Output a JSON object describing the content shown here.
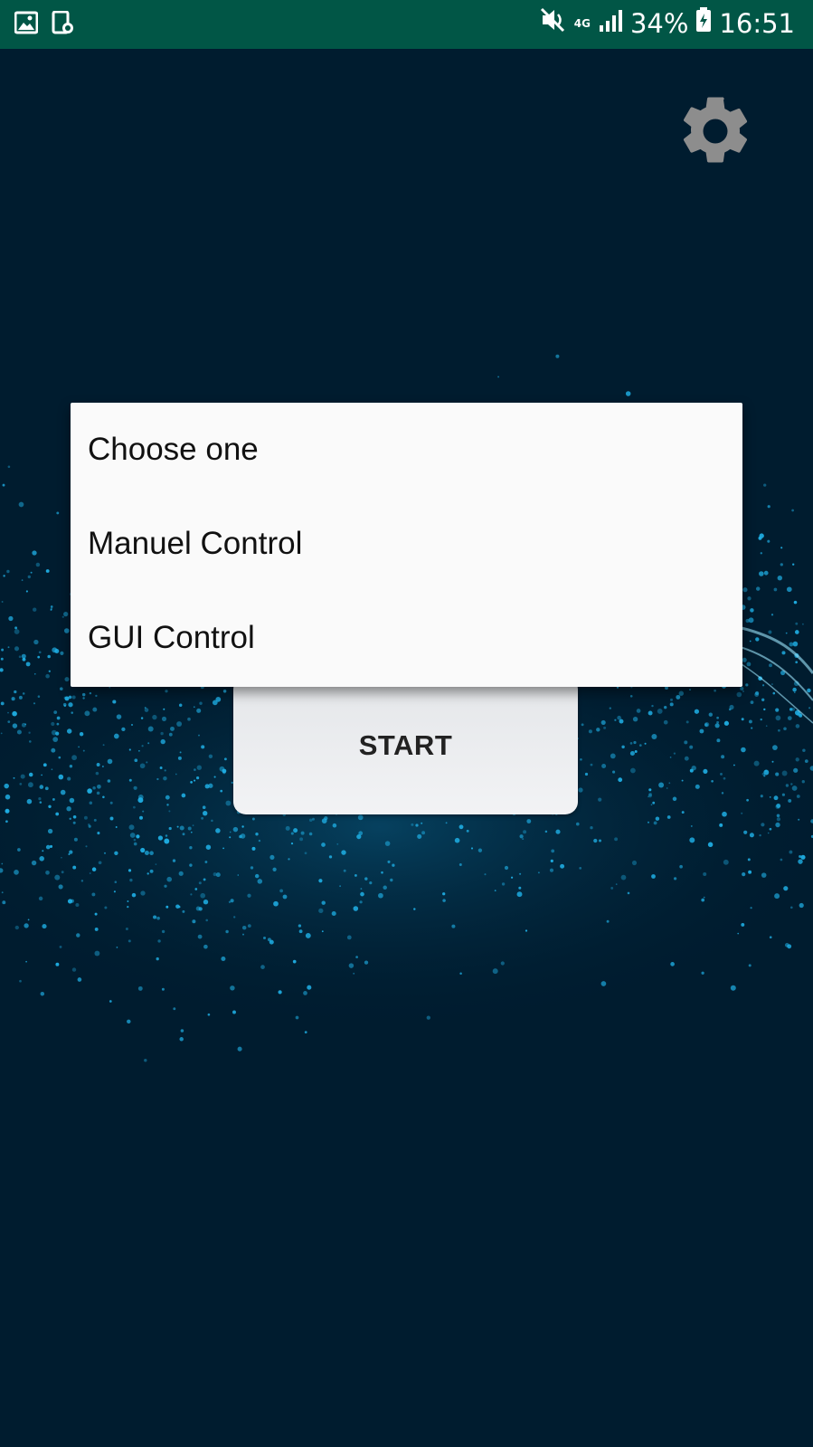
{
  "status_bar": {
    "battery": "34%",
    "time": "16:51",
    "network": "4G",
    "icons": [
      "gallery-icon",
      "screen-record-icon",
      "mute-icon",
      "signal-icon",
      "battery-charging-icon"
    ]
  },
  "toolbar": {
    "settings_icon": "gear-icon"
  },
  "dropdown": {
    "items": [
      {
        "label": "Choose one"
      },
      {
        "label": "Manuel Control"
      },
      {
        "label": "GUI Control"
      }
    ]
  },
  "start_button": {
    "label": "START"
  },
  "colors": {
    "status_bar": "#015646",
    "background": "#001c2f",
    "particles": "#1fb0e6",
    "menu_bg": "#fafafa",
    "gear": "#8d8d8d"
  }
}
